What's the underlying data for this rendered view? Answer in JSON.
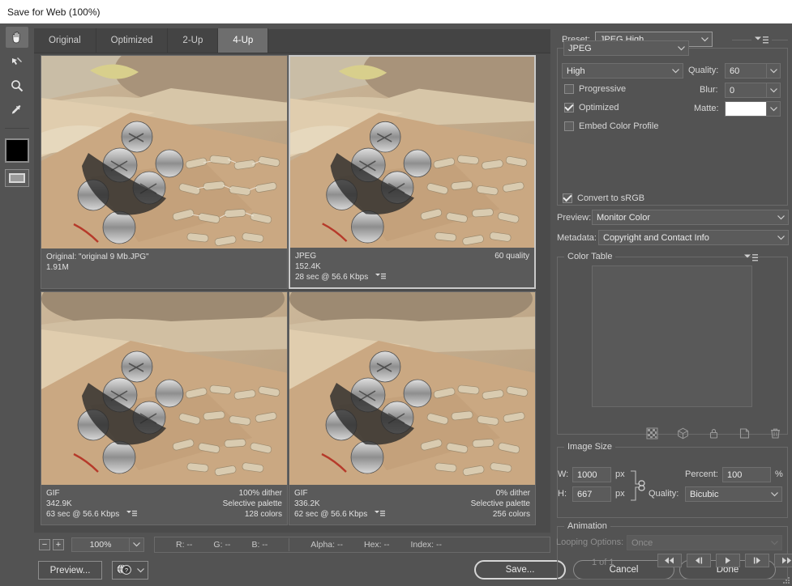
{
  "window": {
    "title": "Save for Web (100%)"
  },
  "toolbar": {
    "tools": [
      {
        "name": "hand-tool",
        "label": "Hand Tool",
        "active": true
      },
      {
        "name": "slice-select-tool",
        "label": "Slice Select Tool",
        "active": false
      },
      {
        "name": "zoom-tool",
        "label": "Zoom Tool",
        "active": false
      },
      {
        "name": "eyedropper-tool",
        "label": "Eyedropper Tool",
        "active": false
      }
    ],
    "foreground_color": "#000000",
    "toggle_slices_label": "Toggle Slices Visibility"
  },
  "tabs": [
    {
      "label": "Original",
      "active": false
    },
    {
      "label": "Optimized",
      "active": false
    },
    {
      "label": "2-Up",
      "active": false
    },
    {
      "label": "4-Up",
      "active": true
    }
  ],
  "previews": [
    {
      "id": "original",
      "selected": false,
      "line1_left": "Original: \"original 9 Mb.JPG\"",
      "line1_right": "",
      "line2_left": "1.91M",
      "line2_right": "",
      "line3_left": "",
      "line3_right": "",
      "has_menu": false
    },
    {
      "id": "jpeg",
      "selected": true,
      "line1_left": "JPEG",
      "line1_right": "60 quality",
      "line2_left": "152.4K",
      "line2_right": "",
      "line3_left": "28 sec @ 56.6 Kbps",
      "line3_right": "",
      "has_menu": true
    },
    {
      "id": "gif-128",
      "selected": false,
      "line1_left": "GIF",
      "line1_right": "100% dither",
      "line2_left": "342.9K",
      "line2_right": "Selective palette",
      "line3_left": "63 sec @ 56.6 Kbps",
      "line3_right": "128 colors",
      "has_menu": true
    },
    {
      "id": "gif-256",
      "selected": false,
      "line1_left": "GIF",
      "line1_right": "0% dither",
      "line2_left": "336.2K",
      "line2_right": "Selective palette",
      "line3_left": "62 sec @ 56.6 Kbps",
      "line3_right": "256 colors",
      "has_menu": true
    }
  ],
  "status": {
    "zoom_out_label": "−",
    "zoom_in_label": "+",
    "zoom_value": "100%",
    "readouts": [
      {
        "label": "R:",
        "value": "--"
      },
      {
        "label": "G:",
        "value": "--"
      },
      {
        "label": "B:",
        "value": "--"
      },
      {
        "label": "Alpha:",
        "value": "--"
      },
      {
        "label": "Hex:",
        "value": "--"
      },
      {
        "label": "Index:",
        "value": "--"
      }
    ]
  },
  "bottom_buttons": {
    "preview": "Preview...",
    "save": "Save...",
    "cancel": "Cancel",
    "done": "Done"
  },
  "settings": {
    "preset_label": "Preset:",
    "preset_value": "JPEG High",
    "format_value": "JPEG",
    "quality_preset_value": "High",
    "quality_label": "Quality:",
    "quality_value": "60",
    "progressive_label": "Progressive",
    "progressive_checked": false,
    "blur_label": "Blur:",
    "blur_value": "0",
    "optimized_label": "Optimized",
    "optimized_checked": true,
    "matte_label": "Matte:",
    "matte_color": "#ffffff",
    "embed_color_profile_label": "Embed Color Profile",
    "embed_color_profile_checked": false,
    "convert_srgb_label": "Convert to sRGB",
    "convert_srgb_checked": true,
    "preview_label": "Preview:",
    "preview_value": "Monitor Color",
    "metadata_label": "Metadata:",
    "metadata_value": "Copyright and Contact Info"
  },
  "color_table": {
    "title": "Color Table",
    "icons": [
      {
        "name": "transparency-icon"
      },
      {
        "name": "web-shift-cube-icon"
      },
      {
        "name": "lock-icon"
      },
      {
        "name": "new-color-icon"
      },
      {
        "name": "delete-color-icon"
      }
    ]
  },
  "image_size": {
    "title": "Image Size",
    "w_label": "W:",
    "w_value": "1000",
    "w_unit": "px",
    "h_label": "H:",
    "h_value": "667",
    "h_unit": "px",
    "percent_label": "Percent:",
    "percent_value": "100",
    "percent_unit": "%",
    "quality_label": "Quality:",
    "quality_value": "Bicubic"
  },
  "animation": {
    "title": "Animation",
    "looping_label": "Looping Options:",
    "looping_value": "Once",
    "frame_counter": "1 of 1",
    "buttons": [
      {
        "name": "first-frame-button",
        "glyph": "◀◀"
      },
      {
        "name": "previous-frame-button",
        "glyph": "◀|"
      },
      {
        "name": "play-button",
        "glyph": "▶"
      },
      {
        "name": "next-frame-button",
        "glyph": "|▶"
      },
      {
        "name": "last-frame-button",
        "glyph": "▶▶"
      }
    ]
  }
}
